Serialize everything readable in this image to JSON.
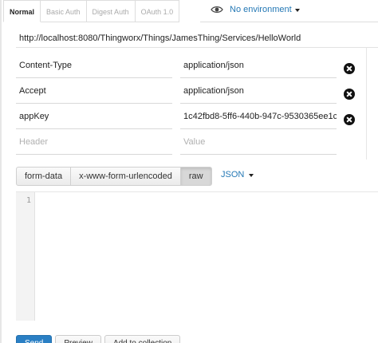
{
  "auth_tabs": [
    {
      "label": "Normal",
      "active": true
    },
    {
      "label": "Basic Auth",
      "active": false
    },
    {
      "label": "Digest Auth",
      "active": false
    },
    {
      "label": "OAuth 1.0",
      "active": false
    }
  ],
  "environment": {
    "icon": "eye-icon",
    "label": "No environment"
  },
  "request": {
    "url": "http://localhost:8080/Thingworx/Things/JamesThing/Services/HelloWorld"
  },
  "headers": [
    {
      "key": "Content-Type",
      "value": "application/json"
    },
    {
      "key": "Accept",
      "value": "application/json"
    },
    {
      "key": "appKey",
      "value": "1c42fbd8-5ff6-440b-947c-9530365ee1c"
    }
  ],
  "header_placeholders": {
    "key": "Header",
    "value": "Value"
  },
  "body_types": [
    {
      "label": "form-data",
      "active": false
    },
    {
      "label": "x-www-form-urlencoded",
      "active": false
    },
    {
      "label": "raw",
      "active": true
    }
  ],
  "raw_format": {
    "label": "JSON"
  },
  "editor": {
    "line_number": "1"
  },
  "actions": {
    "send": "Send",
    "preview": "Preview",
    "add_to_collection": "Add to collection"
  },
  "colors": {
    "link": "#2478b5",
    "primary_button": "#2a7fc4"
  }
}
